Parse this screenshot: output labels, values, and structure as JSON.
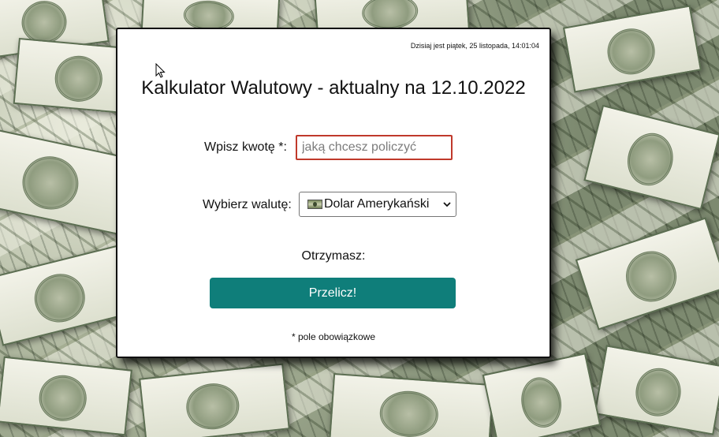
{
  "header": {
    "date_text": "Dzisiaj jest piątek, 25 listopada, 14:01:04",
    "title": "Kalkulator Walutowy - aktualny na 12.10.2022"
  },
  "form": {
    "amount_label": "Wpisz kwotę *:",
    "amount_placeholder": "jaką chcesz policzyć",
    "amount_value": "",
    "currency_label": "Wybierz walutę:",
    "currency_selected": "Dolar Amerykański",
    "currency_flag_icon": "dollar-bill-icon",
    "result_label": "Otrzymasz:",
    "submit_label": "Przelicz!",
    "required_note": "* pole obowiązkowe"
  },
  "colors": {
    "accent": "#0f7e7a",
    "input_border": "#c0392b"
  }
}
